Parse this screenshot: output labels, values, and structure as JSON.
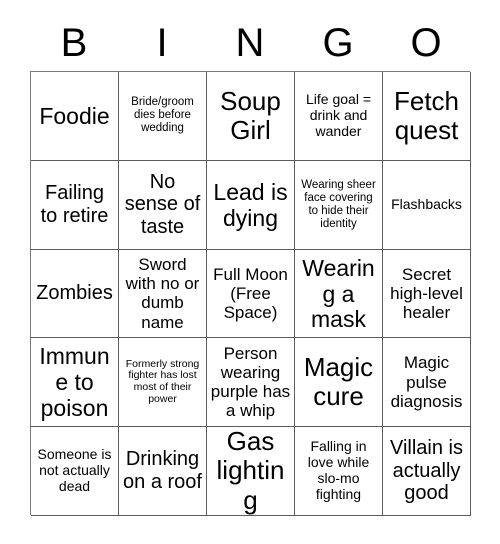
{
  "header": {
    "letters": [
      "B",
      "I",
      "N",
      "G",
      "O"
    ]
  },
  "grid": {
    "rows": 5,
    "columns": 5,
    "free_space_label": "Full Moon (Free Space)",
    "cells": [
      {
        "text": "Foodie",
        "size": "xl"
      },
      {
        "text": "Bride/groom dies before wedding",
        "size": "xs"
      },
      {
        "text": "Soup Girl",
        "size": "xxl"
      },
      {
        "text": "Life goal = drink and wander",
        "size": "sm"
      },
      {
        "text": "Fetch quest",
        "size": "xxl"
      },
      {
        "text": "Failing to retire",
        "size": "lg"
      },
      {
        "text": "No sense of taste",
        "size": "lg"
      },
      {
        "text": "Lead is dying",
        "size": "xl"
      },
      {
        "text": "Wearing sheer face covering to hide their identity",
        "size": "xs"
      },
      {
        "text": "Flashbacks",
        "size": "sm"
      },
      {
        "text": "Zombies",
        "size": "lg"
      },
      {
        "text": "Sword with no or dumb name",
        "size": "md"
      },
      {
        "text": "Full Moon (Free Space)",
        "size": "md"
      },
      {
        "text": "Wearing a mask",
        "size": "xl"
      },
      {
        "text": "Secret high-level healer",
        "size": "md"
      },
      {
        "text": "Immune to poison",
        "size": "xl"
      },
      {
        "text": "Formerly strong fighter has lost most of their power",
        "size": "xxs"
      },
      {
        "text": "Person wearing purple has a whip",
        "size": "md"
      },
      {
        "text": "Magic cure",
        "size": "xxl"
      },
      {
        "text": "Magic pulse diagnosis",
        "size": "md"
      },
      {
        "text": "Someone is not actually dead",
        "size": "sm"
      },
      {
        "text": "Drinking on a roof",
        "size": "lg"
      },
      {
        "text": "Gas lighting",
        "size": "xxl"
      },
      {
        "text": "Falling in love while slo-mo fighting",
        "size": "sm"
      },
      {
        "text": "Villain is actually good",
        "size": "lg"
      }
    ]
  },
  "colors": {
    "background": "#ffffff",
    "text": "#000000",
    "grid_line": "#5c5c5c"
  }
}
